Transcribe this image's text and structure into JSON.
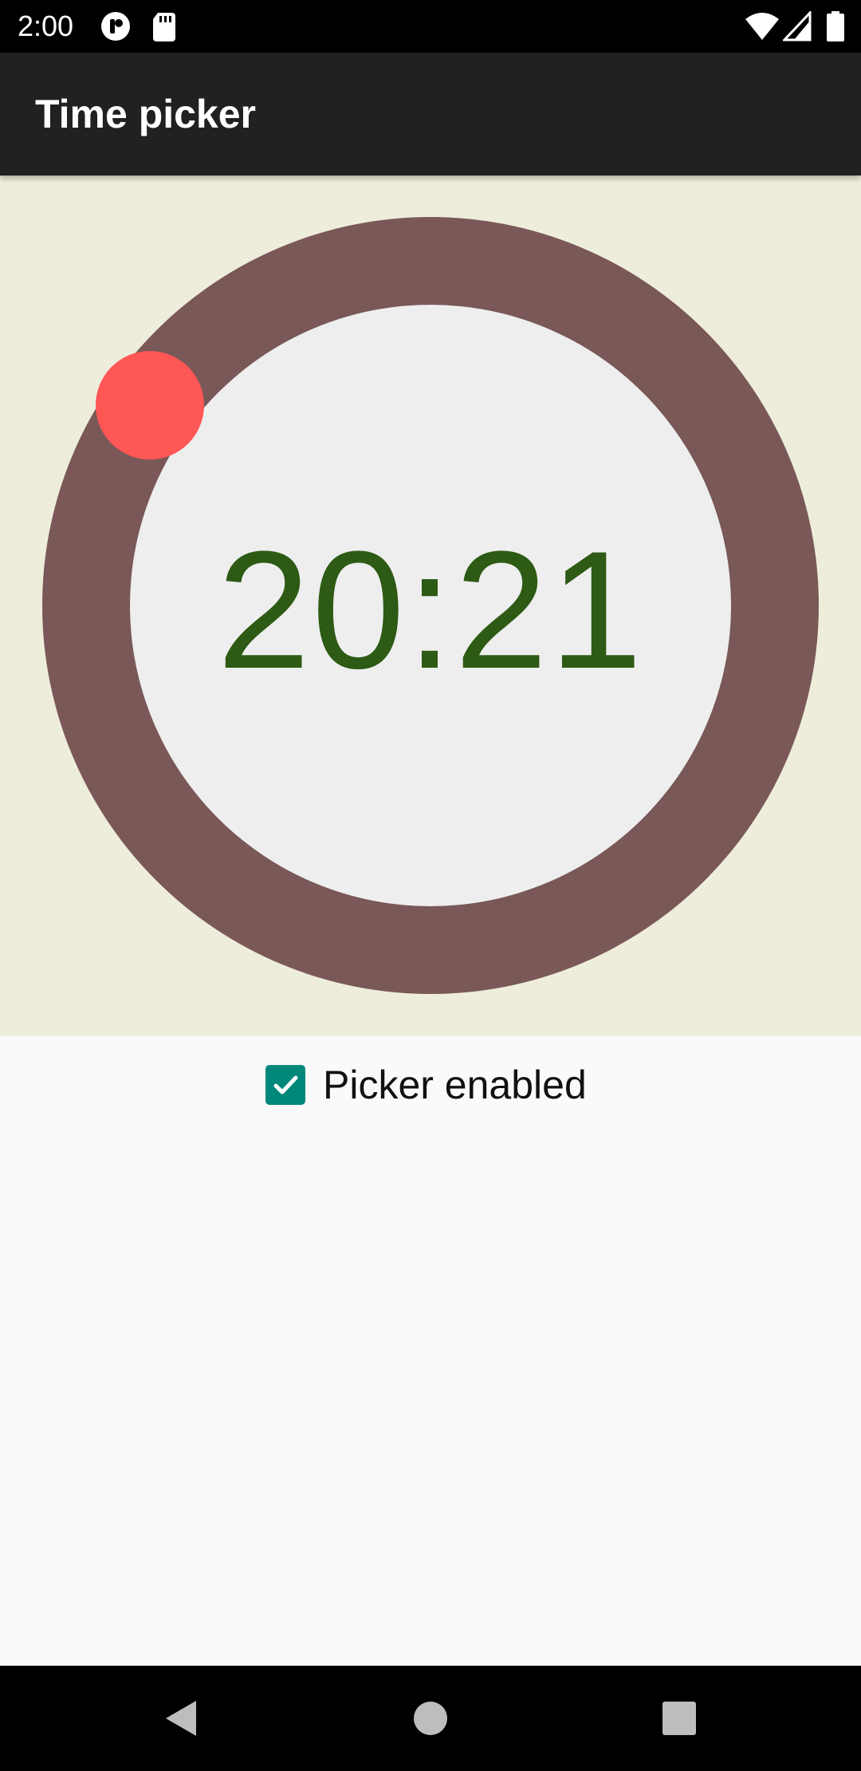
{
  "status_bar": {
    "time": "2:00",
    "icons": [
      "app-notification-icon",
      "sd-card-icon",
      "wifi-icon",
      "cell-signal-icon",
      "battery-icon"
    ]
  },
  "app_bar": {
    "title": "Time picker",
    "background": "#212121"
  },
  "time_picker": {
    "time": "20:21",
    "ring_color": "#7a5858",
    "inner_color": "#eeeeee",
    "handle_color": "#ff5656",
    "text_color": "#2d5a14",
    "area_background": "#eeeddb"
  },
  "checkbox": {
    "label": "Picker enabled",
    "checked": true,
    "accent": "#00897b"
  },
  "nav_bar": {
    "icons": [
      "back-icon",
      "home-icon",
      "recents-icon"
    ]
  }
}
